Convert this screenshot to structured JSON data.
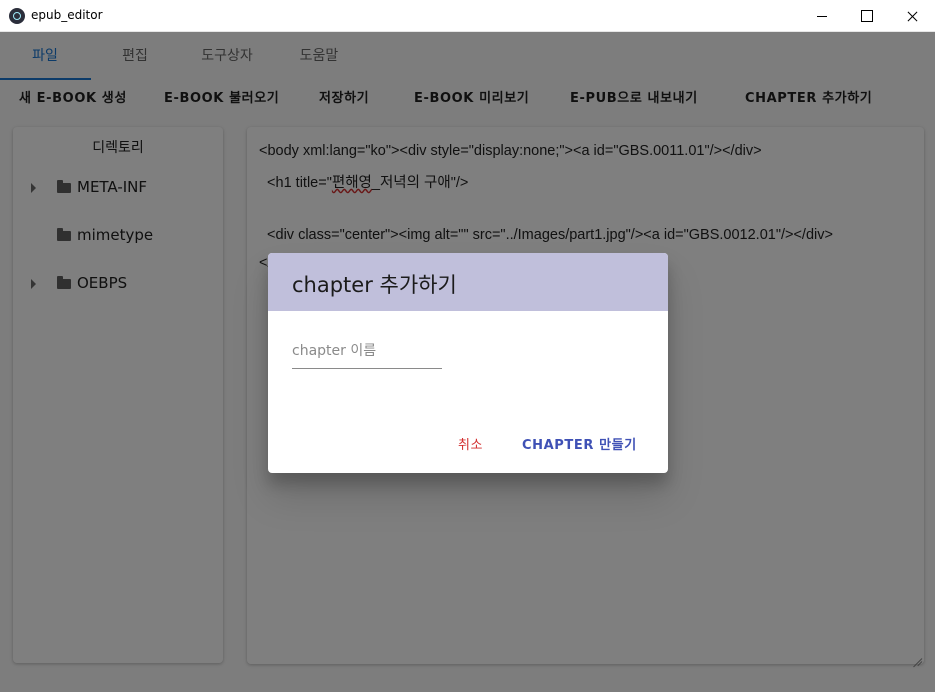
{
  "window": {
    "title": "epub_editor"
  },
  "tabs": [
    {
      "label": "파일",
      "active": true
    },
    {
      "label": "편집"
    },
    {
      "label": "도구상자"
    },
    {
      "label": "도움말"
    }
  ],
  "toolbar": [
    "새 E-BOOK 생성",
    "E-BOOK 불러오기",
    "저장하기",
    "E-BOOK 미리보기",
    "E-PUB으로 내보내기",
    "CHAPTER 추가하기"
  ],
  "sidebar": {
    "title": "디렉토리",
    "items": [
      {
        "label": "META-INF",
        "icon": "folder-icon",
        "expandable": true
      },
      {
        "label": "mimetype",
        "icon": "folder-icon",
        "expandable": false
      },
      {
        "label": "OEBPS",
        "icon": "folder-icon",
        "expandable": true
      }
    ]
  },
  "editor": {
    "line1": "<body xml:lang=\"ko\"><div style=\"display:none;\"><a id=\"GBS.0011.01\"/></div>",
    "line2_pre": "  <h1 title=\"",
    "line2_spell": "편해영",
    "line2_post": "_저녁의 구애\"/>",
    "line3": "  <div class=\"center\"><img alt=\"\" src=\"../Images/part1.jpg\"/><a id=\"GBS.0012.01\"/></div>",
    "line4": "</body>"
  },
  "dialog": {
    "title": "chapter 추가하기",
    "input_placeholder": "chapter 이름",
    "input_value": "",
    "cancel_label": "취소",
    "create_label": "CHAPTER 만들기"
  },
  "colors": {
    "accent": "#1976d2",
    "dialog_header": "#c0bfdb",
    "cancel": "#d32f2f",
    "create": "#3f51b5"
  }
}
